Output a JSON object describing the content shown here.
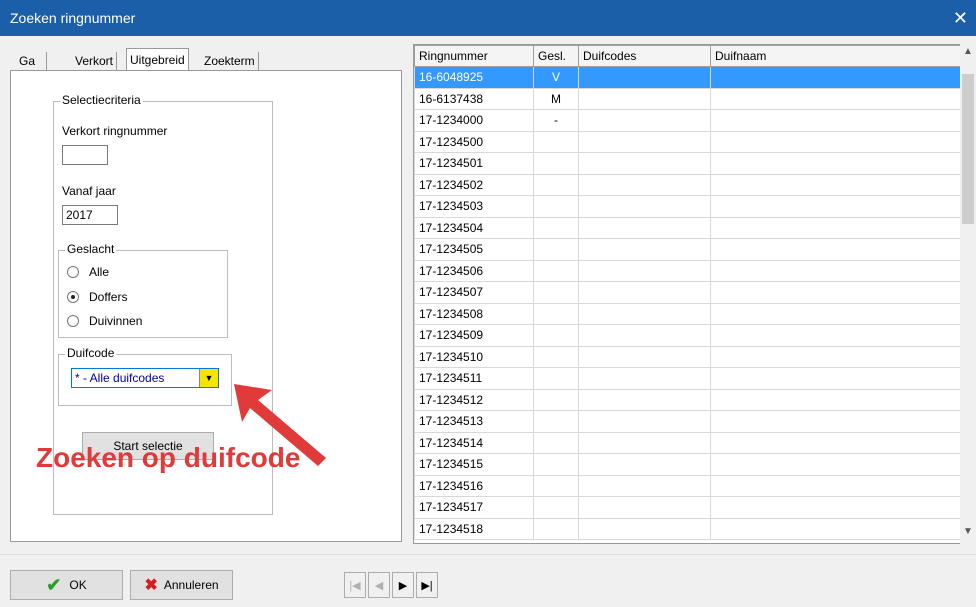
{
  "window": {
    "title": "Zoeken ringnummer",
    "close": "✕"
  },
  "tabs": [
    "Ga naar",
    "Verkort",
    "Uitgebreid",
    "Zoekterm"
  ],
  "criteria": {
    "group_label": "Selectiecriteria",
    "verkort_label": "Verkort ringnummer",
    "verkort_value": "",
    "vanaf_label": "Vanaf jaar",
    "vanaf_value": "2017",
    "geslacht_label": "Geslacht",
    "geslacht_options": [
      "Alle",
      "Doffers",
      "Duivinnen"
    ],
    "geslacht_selected": "Doffers",
    "duifcode_label": "Duifcode",
    "duifcode_value": "* - Alle duifcodes",
    "start_button": "Start selectie"
  },
  "annotation": "Zoeken op duifcode",
  "grid": {
    "columns": [
      "Ringnummer",
      "Gesl.",
      "Duifcodes",
      "Duifnaam"
    ],
    "rows": [
      [
        "16-6048925",
        "V",
        "",
        ""
      ],
      [
        "16-6137438",
        "M",
        "",
        ""
      ],
      [
        "17-1234000",
        "-",
        "",
        ""
      ],
      [
        "17-1234500",
        "",
        "",
        ""
      ],
      [
        "17-1234501",
        "",
        "",
        ""
      ],
      [
        "17-1234502",
        "",
        "",
        ""
      ],
      [
        "17-1234503",
        "",
        "",
        ""
      ],
      [
        "17-1234504",
        "",
        "",
        ""
      ],
      [
        "17-1234505",
        "",
        "",
        ""
      ],
      [
        "17-1234506",
        "",
        "",
        ""
      ],
      [
        "17-1234507",
        "",
        "",
        ""
      ],
      [
        "17-1234508",
        "",
        "",
        ""
      ],
      [
        "17-1234509",
        "",
        "",
        ""
      ],
      [
        "17-1234510",
        "",
        "",
        ""
      ],
      [
        "17-1234511",
        "",
        "",
        ""
      ],
      [
        "17-1234512",
        "",
        "",
        ""
      ],
      [
        "17-1234513",
        "",
        "",
        ""
      ],
      [
        "17-1234514",
        "",
        "",
        ""
      ],
      [
        "17-1234515",
        "",
        "",
        ""
      ],
      [
        "17-1234516",
        "",
        "",
        ""
      ],
      [
        "17-1234517",
        "",
        "",
        ""
      ],
      [
        "17-1234518",
        "",
        "",
        ""
      ]
    ],
    "selected_row": 0
  },
  "buttons": {
    "ok": "OK",
    "cancel": "Annuleren"
  },
  "nav": {
    "first": "|◀",
    "prev": "◀",
    "next": "▶",
    "last": "▶|"
  },
  "colors": {
    "titlebar": "#1a5fa8",
    "selection": "#3399ff",
    "annotation": "#e03a3a",
    "dropdown_arrow": "#f5e600"
  }
}
